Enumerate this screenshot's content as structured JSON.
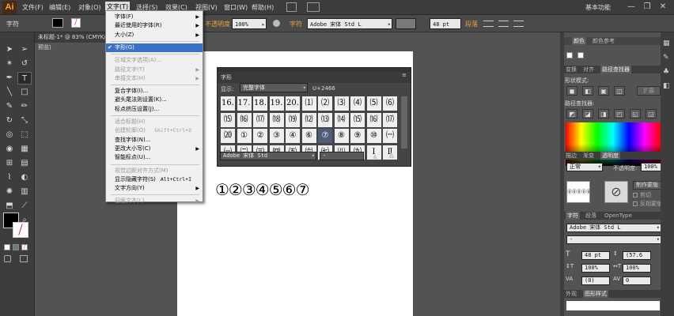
{
  "app": {
    "logo": "Ai",
    "workspace": "基本功能",
    "window_buttons": [
      "—",
      "❐",
      "✕"
    ]
  },
  "menubar": {
    "items": [
      "文件(F)",
      "编辑(E)",
      "对象(O)",
      "文字(T)",
      "选择(S)",
      "效果(C)",
      "视图(V)",
      "窗口(W)",
      "帮助(H)"
    ]
  },
  "controlbar": {
    "label": "字符",
    "opacity_label": "不透明度",
    "opacity_value": "100%",
    "char_label": "字符",
    "font": "Adobe 宋体 Std L",
    "size": "48 pt",
    "para_label": "段落"
  },
  "document": {
    "tab": "未标题-1* @ 83% (CMYK/预览)"
  },
  "type_menu": {
    "items": [
      {
        "label": "字体(F)",
        "arrow": true
      },
      {
        "label": "最近使用的字体(R)",
        "arrow": true
      },
      {
        "label": "大小(Z)",
        "arrow": true
      },
      {
        "label": "字形(G)",
        "checked": true,
        "highlight": true
      },
      {
        "label": "区域文字选项(A)...",
        "disabled": true
      },
      {
        "label": "路径文字(T)",
        "disabled": true,
        "arrow": true
      },
      {
        "label": "串接文本(H)",
        "disabled": true,
        "arrow": true
      },
      {
        "label": "复合字体(I)..."
      },
      {
        "label": "避头尾法则设置(K)..."
      },
      {
        "label": "标点挤压设置(J)..."
      },
      {
        "label": "适合标题(H)",
        "disabled": true
      },
      {
        "label": "创建轮廓(O)",
        "disabled": true,
        "shortcut": "Shift+Ctrl+O"
      },
      {
        "label": "查找字体(N)..."
      },
      {
        "label": "更改大小写(C)",
        "arrow": true
      },
      {
        "label": "智能标点(U)..."
      },
      {
        "label": "视觉边距对齐方式(M)",
        "disabled": true
      },
      {
        "label": "显示隐藏字符(S)",
        "shortcut": "Alt+Ctrl+I"
      },
      {
        "label": "文字方向(Y)",
        "arrow": true
      },
      {
        "label": "旧版文本(L)",
        "disabled": true,
        "arrow": true
      }
    ]
  },
  "glyphs_panel": {
    "title": "字形",
    "show_label": "显示:",
    "show_value": "完整字体",
    "code": "U+2466",
    "rows": [
      [
        "16.",
        "17.",
        "18.",
        "19.",
        "20.",
        "⑴",
        "⑵",
        "⑶",
        "⑷",
        "⑸",
        "⑹"
      ],
      [
        "⒂",
        "⒃",
        "⒄",
        "⒅",
        "⒆",
        "⑿",
        "⒀",
        "⒁",
        "⒂",
        "⒃",
        "⒄"
      ],
      [
        "⒇",
        "①",
        "②",
        "③",
        "④",
        "⑥",
        "⑦",
        "⑧",
        "⑨",
        "⑩",
        "㈠"
      ],
      [
        "㈠",
        "㈡",
        "㈢",
        "㈣",
        "㈤",
        "㈥",
        "㈦",
        "㈧",
        "㈨",
        "Ⅰ",
        "Ⅱ"
      ]
    ],
    "font": "Adobe 宋体 Std",
    "style": "-"
  },
  "artboard_text": "①②③④⑤⑥⑦",
  "right_panels": {
    "color_tabs": [
      "颜色",
      "颜色参考"
    ],
    "align_tabs": [
      "变换",
      "对齐",
      "路径查找器"
    ],
    "shape_modes_label": "形状模式:",
    "pathfinder_label": "路径查找器:",
    "expand_label": "扩展",
    "transparency_tabs": [
      "描边",
      "渐变",
      "透明度"
    ],
    "blend_mode": "正常",
    "opacity_label": "不透明度:",
    "opacity_value": "100%",
    "make_mask": "制作蒙版",
    "clip": "剪切",
    "invert_mask": "反相蒙版",
    "char_tabs": [
      "字符",
      "段落",
      "OpenType"
    ],
    "font": "Adobe 宋体 Std L",
    "font_style": "-",
    "size": "48 pt",
    "leading": "(57.6",
    "tracking": "100%",
    "scale": "100%",
    "kerning": "(0)",
    "kerning2": "0",
    "bottom_tabs": [
      "外观",
      "图形样式"
    ]
  }
}
